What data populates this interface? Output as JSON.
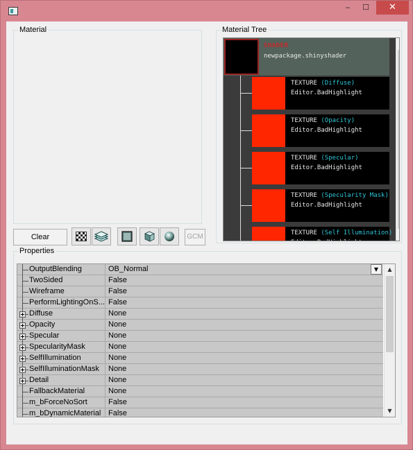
{
  "window": {
    "minimize_glyph": "‒",
    "maximize_glyph": "☐",
    "close_glyph": "✕"
  },
  "material": {
    "label": "Material"
  },
  "material_tree": {
    "label": "Material Tree",
    "shader": {
      "type_label": "SHADER",
      "name": "newpackage.shinyshader"
    },
    "textures": [
      {
        "type_label": "TEXTURE",
        "slot": "(Diffuse)",
        "name": "Editor.BadHighlight"
      },
      {
        "type_label": "TEXTURE",
        "slot": "(Opacity)",
        "name": "Editor.BadHighlight"
      },
      {
        "type_label": "TEXTURE",
        "slot": "(Specular)",
        "name": "Editor.BadHighlight"
      },
      {
        "type_label": "TEXTURE",
        "slot": "(Specularity Mask)",
        "name": "Editor.BadHighlight"
      },
      {
        "type_label": "TEXTURE",
        "slot": "(Self Illumination)",
        "name": "Editor.BadHighlight"
      }
    ],
    "colors": {
      "background": "#3b3b3b",
      "shader_row": "#53625a",
      "shader_title": "#c22a2a",
      "texture_thumb": "#ff2600",
      "slot_text": "#2fc5d6"
    }
  },
  "toolbar": {
    "clear_label": "Clear",
    "gcm_label": "GCM",
    "tools": [
      "checker-icon",
      "layers-icon",
      "plane-icon",
      "cube-icon",
      "sphere-icon"
    ]
  },
  "properties": {
    "label": "Properties",
    "rows": [
      {
        "name": "OutputBlending",
        "value": "OB_Normal",
        "expandable": false
      },
      {
        "name": "TwoSided",
        "value": "False",
        "expandable": false
      },
      {
        "name": "Wireframe",
        "value": "False",
        "expandable": false
      },
      {
        "name": "PerformLightingOnS...",
        "value": "False",
        "expandable": false
      },
      {
        "name": "Diffuse",
        "value": "None",
        "expandable": true
      },
      {
        "name": "Opacity",
        "value": "None",
        "expandable": true
      },
      {
        "name": "Specular",
        "value": "None",
        "expandable": true
      },
      {
        "name": "SpecularityMask",
        "value": "None",
        "expandable": true
      },
      {
        "name": "SelfIllumination",
        "value": "None",
        "expandable": true
      },
      {
        "name": "SelfIlluminationMask",
        "value": "None",
        "expandable": true
      },
      {
        "name": "Detail",
        "value": "None",
        "expandable": true
      },
      {
        "name": "FallbackMaterial",
        "value": "None",
        "expandable": false
      },
      {
        "name": "m_bForceNoSort",
        "value": "False",
        "expandable": false
      },
      {
        "name": "m_bDynamicMaterial",
        "value": "False",
        "expandable": false
      }
    ]
  }
}
